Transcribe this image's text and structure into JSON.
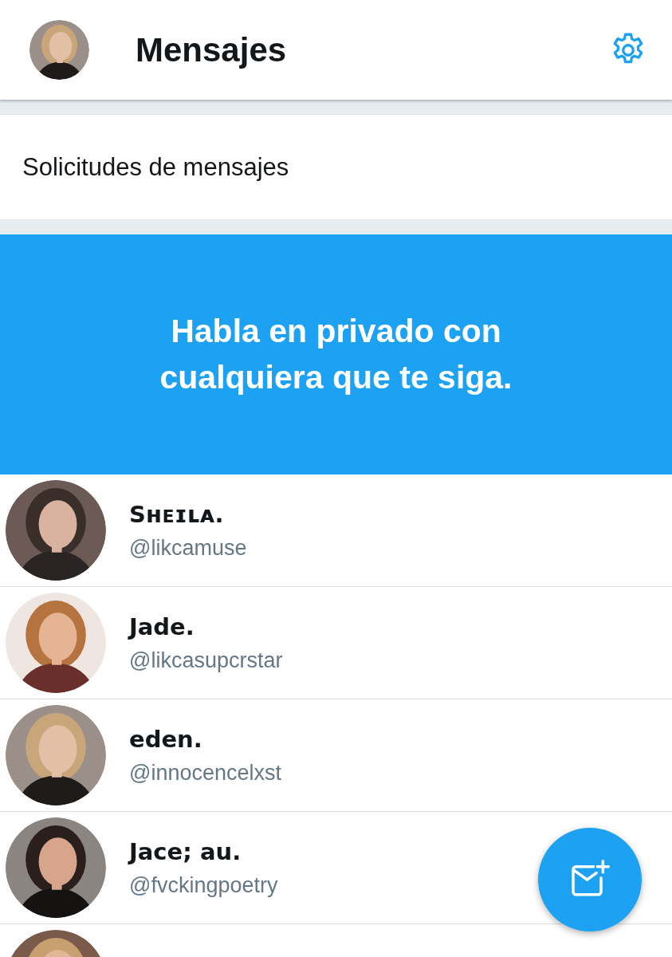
{
  "header": {
    "title": "Mensajes"
  },
  "requests": {
    "label": "Solicitudes de mensajes"
  },
  "banner": {
    "text": "Habla en privado con cualquiera que te siga."
  },
  "conversations": [
    {
      "name": "Sʜᴇɪʟᴀ.",
      "handle": "@likcamuse"
    },
    {
      "name": "Jade.",
      "handle": "@likcasupcrstar"
    },
    {
      "name": "eden.",
      "handle": "@innocencelxst"
    },
    {
      "name": "Jace; au.",
      "handle": "@fvckingpoetry"
    }
  ]
}
